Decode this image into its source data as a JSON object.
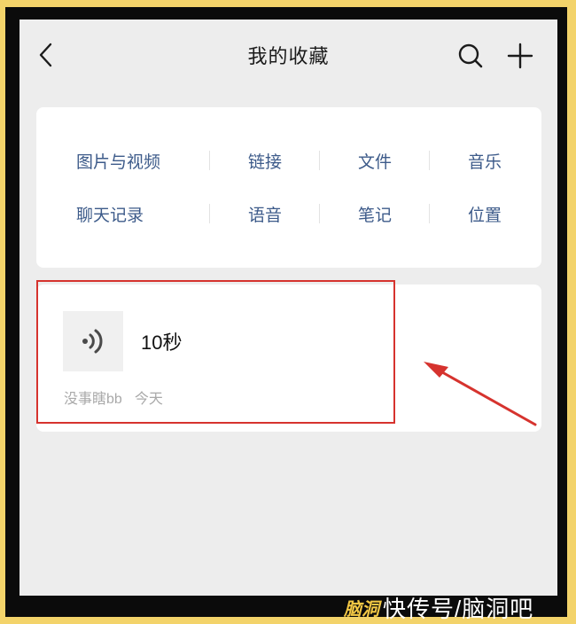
{
  "header": {
    "title": "我的收藏",
    "back_icon": "chevron-left-icon",
    "search_icon": "search-icon",
    "add_icon": "plus-icon"
  },
  "categories": {
    "row1": [
      "图片与视频",
      "链接",
      "文件",
      "音乐"
    ],
    "row2": [
      "聊天记录",
      "语音",
      "笔记",
      "位置"
    ]
  },
  "favorite_item": {
    "icon": "voice-icon",
    "title": "10秒",
    "source": "没事瞎bb",
    "time": "今天"
  },
  "annotation": {
    "highlight_color": "#d6332e"
  },
  "watermark": {
    "brand": "脑洞",
    "text": "快传号/脑洞吧"
  },
  "colors": {
    "category_text": "#3d5b8a",
    "background": "#ededed",
    "card": "#ffffff"
  }
}
